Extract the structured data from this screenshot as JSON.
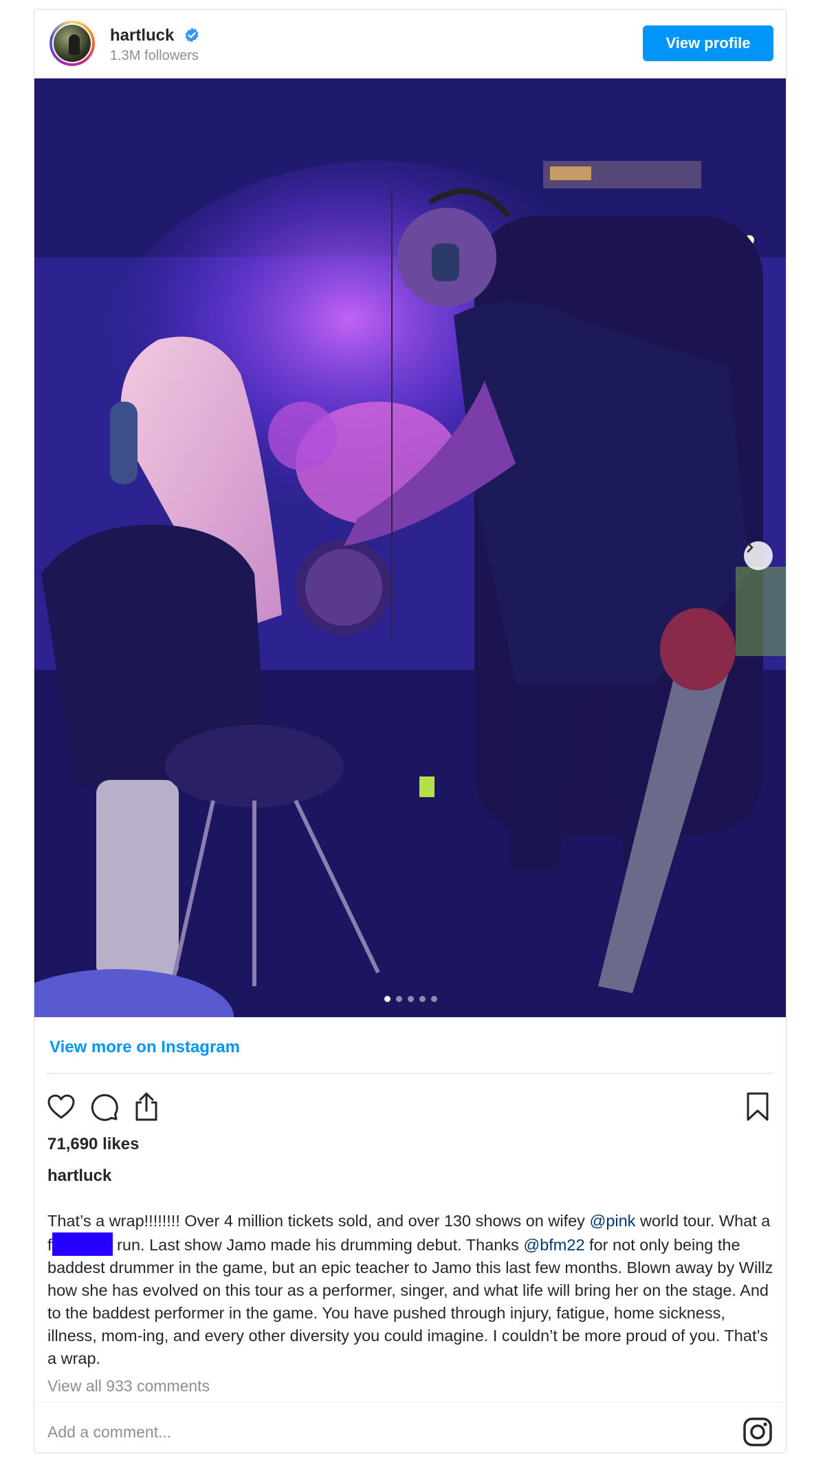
{
  "post": {
    "username": "hartluck",
    "followers": "1.3M followers",
    "view_profile_label": "View profile",
    "view_more_label": "View more on Instagram",
    "likes": "71,690 likes",
    "caption_user": "hartluck",
    "caption": {
      "part1": "That’s a wrap!!!!!!!! Over 4 million tickets sold, and over 130 shows on wifey ",
      "mention1": "@pink",
      "part2": " world tour. What a ",
      "part2b": "f",
      "part3": " run. Last show Jamo made his drumming debut. Thanks ",
      "mention2": "@bfm22",
      "part4": " for not only being the baddest drummer in the game, but an epic teacher to Jamo this last few months. Blown away by Willz how she has evolved on this tour as a performer, singer, and what life will bring her on the stage. And to the baddest performer in the game. You have pushed through injury, fatigue, home sickness, illness, mom-ing, and every other diversity you could imagine. I couldn’t be more proud of you. That’s a wrap."
    },
    "view_comments": "View all 933 comments",
    "comment_placeholder": "Add a comment...",
    "carousel": {
      "total_slides": 5,
      "active_slide": 1
    }
  },
  "colors": {
    "accent": "#0095f6",
    "mention": "#00376b",
    "muted": "#8e8e8e",
    "redaction": "#2600ff"
  },
  "icons": [
    "verified-badge-icon",
    "chevron-right-icon",
    "heart-icon",
    "comment-icon",
    "share-icon",
    "bookmark-icon",
    "instagram-logo-icon"
  ]
}
